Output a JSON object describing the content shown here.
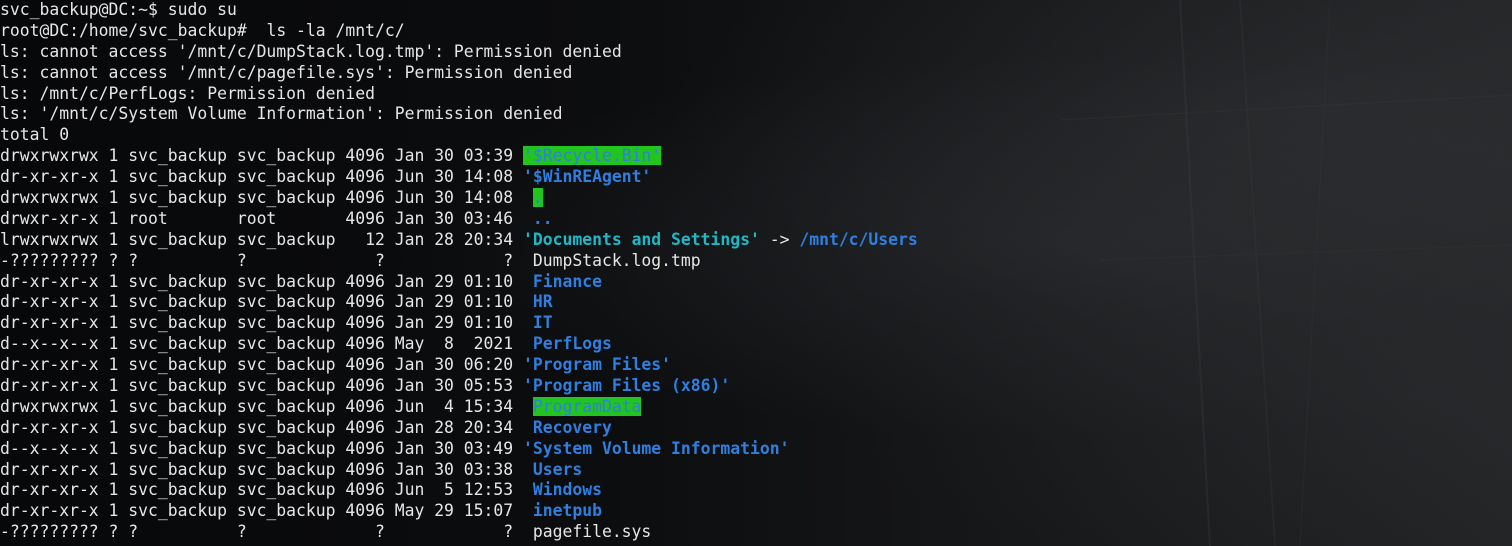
{
  "terminal": {
    "command_lines": [
      {
        "prompt": "svc_backup@DC:~$ ",
        "command": "sudo su"
      },
      {
        "prompt": "root@DC:/home/svc_backup# ",
        "command": " ls -la /mnt/c/"
      }
    ],
    "errors": [
      "ls: cannot access '/mnt/c/DumpStack.log.tmp': Permission denied",
      "ls: cannot access '/mnt/c/pagefile.sys': Permission denied",
      "ls: /mnt/c/PerfLogs: Permission denied",
      "ls: '/mnt/c/System Volume Information': Permission denied"
    ],
    "total": "total 0",
    "entries": [
      {
        "meta": "drwxrwxrwx 1 svc_backup svc_backup 4096 Jan 30 03:39 ",
        "name": "'$Recycle.Bin'",
        "style": "dir-hl"
      },
      {
        "meta": "dr-xr-xr-x 1 svc_backup svc_backup 4096 Jun 30 14:08 ",
        "name": "'$WinREAgent'",
        "style": "dir"
      },
      {
        "meta": "drwxrwxrwx 1 svc_backup svc_backup 4096 Jun 30 14:08  ",
        "name": ".",
        "style": "dir-hl"
      },
      {
        "meta": "drwxr-xr-x 1 root       root       4096 Jan 30 03:46  ",
        "name": "..",
        "style": "dir"
      },
      {
        "meta": "lrwxrwxrwx 1 svc_backup svc_backup   12 Jan 28 20:34 ",
        "name": "'Documents and Settings'",
        "style": "link",
        "arrow": " -> ",
        "target": "/mnt/c/Users"
      },
      {
        "meta": "-????????? ? ?          ?             ?            ?  ",
        "name": "DumpStack.log.tmp",
        "style": "file"
      },
      {
        "meta": "dr-xr-xr-x 1 svc_backup svc_backup 4096 Jan 29 01:10  ",
        "name": "Finance",
        "style": "dir"
      },
      {
        "meta": "dr-xr-xr-x 1 svc_backup svc_backup 4096 Jan 29 01:10  ",
        "name": "HR",
        "style": "dir"
      },
      {
        "meta": "dr-xr-xr-x 1 svc_backup svc_backup 4096 Jan 29 01:10  ",
        "name": "IT",
        "style": "dir"
      },
      {
        "meta": "d--x--x--x 1 svc_backup svc_backup 4096 May  8  2021  ",
        "name": "PerfLogs",
        "style": "dir"
      },
      {
        "meta": "dr-xr-xr-x 1 svc_backup svc_backup 4096 Jan 30 06:20 ",
        "name": "'Program Files'",
        "style": "dir"
      },
      {
        "meta": "dr-xr-xr-x 1 svc_backup svc_backup 4096 Jan 30 05:53 ",
        "name": "'Program Files (x86)'",
        "style": "dir"
      },
      {
        "meta": "drwxrwxrwx 1 svc_backup svc_backup 4096 Jun  4 15:34  ",
        "name": "ProgramData",
        "style": "dir-hl"
      },
      {
        "meta": "dr-xr-xr-x 1 svc_backup svc_backup 4096 Jan 28 20:34  ",
        "name": "Recovery",
        "style": "dir"
      },
      {
        "meta": "d--x--x--x 1 svc_backup svc_backup 4096 Jan 30 03:49 ",
        "name": "'System Volume Information'",
        "style": "dir"
      },
      {
        "meta": "dr-xr-xr-x 1 svc_backup svc_backup 4096 Jan 30 03:38  ",
        "name": "Users",
        "style": "dir"
      },
      {
        "meta": "dr-xr-xr-x 1 svc_backup svc_backup 4096 Jun  5 12:53  ",
        "name": "Windows",
        "style": "dir"
      },
      {
        "meta": "dr-xr-xr-x 1 svc_backup svc_backup 4096 May 29 15:07  ",
        "name": "inetpub",
        "style": "dir"
      },
      {
        "meta": "-????????? ? ?          ?             ?            ?  ",
        "name": "pagefile.sys",
        "style": "file"
      }
    ],
    "colors": {
      "background": "#0b0c0d",
      "text": "#e6e6e6",
      "directory": "#2f7fe0",
      "symlink": "#1fb8c6",
      "highlight": "#22c41f"
    }
  }
}
